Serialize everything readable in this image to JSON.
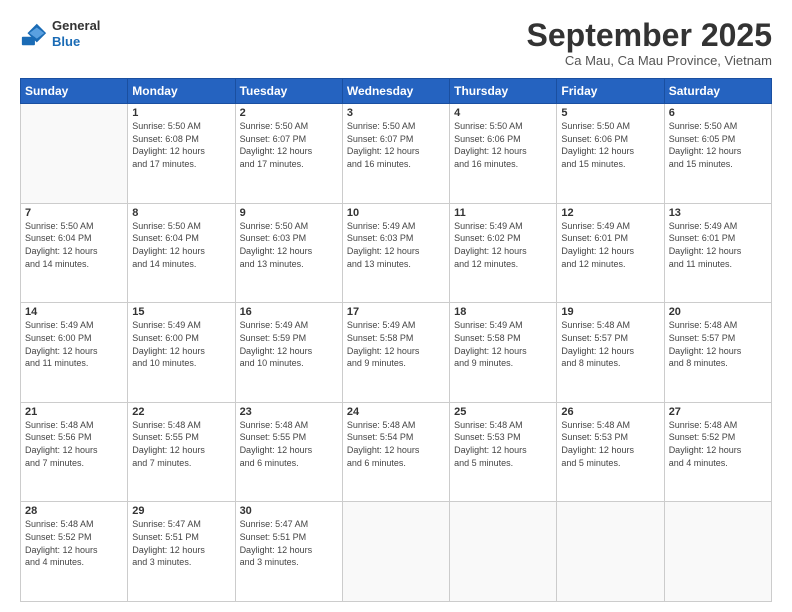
{
  "header": {
    "logo": {
      "line1": "General",
      "line2": "Blue"
    },
    "title": "September 2025",
    "location": "Ca Mau, Ca Mau Province, Vietnam"
  },
  "calendar": {
    "days_of_week": [
      "Sunday",
      "Monday",
      "Tuesday",
      "Wednesday",
      "Thursday",
      "Friday",
      "Saturday"
    ],
    "weeks": [
      [
        {
          "day": "",
          "info": ""
        },
        {
          "day": "1",
          "info": "Sunrise: 5:50 AM\nSunset: 6:08 PM\nDaylight: 12 hours\nand 17 minutes."
        },
        {
          "day": "2",
          "info": "Sunrise: 5:50 AM\nSunset: 6:07 PM\nDaylight: 12 hours\nand 17 minutes."
        },
        {
          "day": "3",
          "info": "Sunrise: 5:50 AM\nSunset: 6:07 PM\nDaylight: 12 hours\nand 16 minutes."
        },
        {
          "day": "4",
          "info": "Sunrise: 5:50 AM\nSunset: 6:06 PM\nDaylight: 12 hours\nand 16 minutes."
        },
        {
          "day": "5",
          "info": "Sunrise: 5:50 AM\nSunset: 6:06 PM\nDaylight: 12 hours\nand 15 minutes."
        },
        {
          "day": "6",
          "info": "Sunrise: 5:50 AM\nSunset: 6:05 PM\nDaylight: 12 hours\nand 15 minutes."
        }
      ],
      [
        {
          "day": "7",
          "info": "Sunrise: 5:50 AM\nSunset: 6:04 PM\nDaylight: 12 hours\nand 14 minutes."
        },
        {
          "day": "8",
          "info": "Sunrise: 5:50 AM\nSunset: 6:04 PM\nDaylight: 12 hours\nand 14 minutes."
        },
        {
          "day": "9",
          "info": "Sunrise: 5:50 AM\nSunset: 6:03 PM\nDaylight: 12 hours\nand 13 minutes."
        },
        {
          "day": "10",
          "info": "Sunrise: 5:49 AM\nSunset: 6:03 PM\nDaylight: 12 hours\nand 13 minutes."
        },
        {
          "day": "11",
          "info": "Sunrise: 5:49 AM\nSunset: 6:02 PM\nDaylight: 12 hours\nand 12 minutes."
        },
        {
          "day": "12",
          "info": "Sunrise: 5:49 AM\nSunset: 6:01 PM\nDaylight: 12 hours\nand 12 minutes."
        },
        {
          "day": "13",
          "info": "Sunrise: 5:49 AM\nSunset: 6:01 PM\nDaylight: 12 hours\nand 11 minutes."
        }
      ],
      [
        {
          "day": "14",
          "info": "Sunrise: 5:49 AM\nSunset: 6:00 PM\nDaylight: 12 hours\nand 11 minutes."
        },
        {
          "day": "15",
          "info": "Sunrise: 5:49 AM\nSunset: 6:00 PM\nDaylight: 12 hours\nand 10 minutes."
        },
        {
          "day": "16",
          "info": "Sunrise: 5:49 AM\nSunset: 5:59 PM\nDaylight: 12 hours\nand 10 minutes."
        },
        {
          "day": "17",
          "info": "Sunrise: 5:49 AM\nSunset: 5:58 PM\nDaylight: 12 hours\nand 9 minutes."
        },
        {
          "day": "18",
          "info": "Sunrise: 5:49 AM\nSunset: 5:58 PM\nDaylight: 12 hours\nand 9 minutes."
        },
        {
          "day": "19",
          "info": "Sunrise: 5:48 AM\nSunset: 5:57 PM\nDaylight: 12 hours\nand 8 minutes."
        },
        {
          "day": "20",
          "info": "Sunrise: 5:48 AM\nSunset: 5:57 PM\nDaylight: 12 hours\nand 8 minutes."
        }
      ],
      [
        {
          "day": "21",
          "info": "Sunrise: 5:48 AM\nSunset: 5:56 PM\nDaylight: 12 hours\nand 7 minutes."
        },
        {
          "day": "22",
          "info": "Sunrise: 5:48 AM\nSunset: 5:55 PM\nDaylight: 12 hours\nand 7 minutes."
        },
        {
          "day": "23",
          "info": "Sunrise: 5:48 AM\nSunset: 5:55 PM\nDaylight: 12 hours\nand 6 minutes."
        },
        {
          "day": "24",
          "info": "Sunrise: 5:48 AM\nSunset: 5:54 PM\nDaylight: 12 hours\nand 6 minutes."
        },
        {
          "day": "25",
          "info": "Sunrise: 5:48 AM\nSunset: 5:53 PM\nDaylight: 12 hours\nand 5 minutes."
        },
        {
          "day": "26",
          "info": "Sunrise: 5:48 AM\nSunset: 5:53 PM\nDaylight: 12 hours\nand 5 minutes."
        },
        {
          "day": "27",
          "info": "Sunrise: 5:48 AM\nSunset: 5:52 PM\nDaylight: 12 hours\nand 4 minutes."
        }
      ],
      [
        {
          "day": "28",
          "info": "Sunrise: 5:48 AM\nSunset: 5:52 PM\nDaylight: 12 hours\nand 4 minutes."
        },
        {
          "day": "29",
          "info": "Sunrise: 5:47 AM\nSunset: 5:51 PM\nDaylight: 12 hours\nand 3 minutes."
        },
        {
          "day": "30",
          "info": "Sunrise: 5:47 AM\nSunset: 5:51 PM\nDaylight: 12 hours\nand 3 minutes."
        },
        {
          "day": "",
          "info": ""
        },
        {
          "day": "",
          "info": ""
        },
        {
          "day": "",
          "info": ""
        },
        {
          "day": "",
          "info": ""
        }
      ]
    ]
  }
}
